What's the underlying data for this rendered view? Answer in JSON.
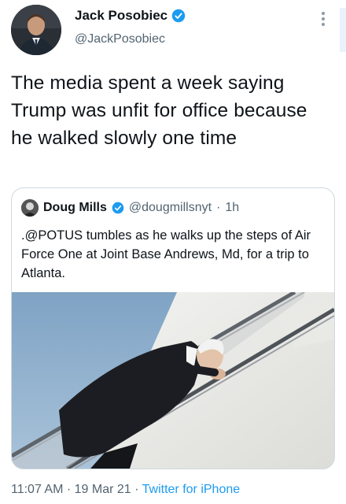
{
  "tweet": {
    "author_name": "Jack Posobiec",
    "author_handle": "@JackPosobiec",
    "text": "The media spent a week saying Trump was unfit for office because he walked slowly one time"
  },
  "quoted_tweet": {
    "author_name": "Doug Mills",
    "author_handle": "@dougmillsnyt",
    "separator": "·",
    "time_ago": "1h",
    "text": ".@POTUS tumbles as he walks up the steps of Air Force One at Joint Base Andrews, Md, for a trip to Atlanta."
  },
  "footer": {
    "time": "11:07 AM",
    "sep1": "·",
    "date": "19 Mar 21",
    "sep2": "·",
    "app": "Twitter for iPhone"
  },
  "colors": {
    "verified": "#1d9bf0",
    "link": "#1d9bf0",
    "secondary_text": "#536471",
    "border": "#cfd9de"
  },
  "icons": {
    "verified": "verified-badge-icon",
    "more": "more-options-icon"
  }
}
